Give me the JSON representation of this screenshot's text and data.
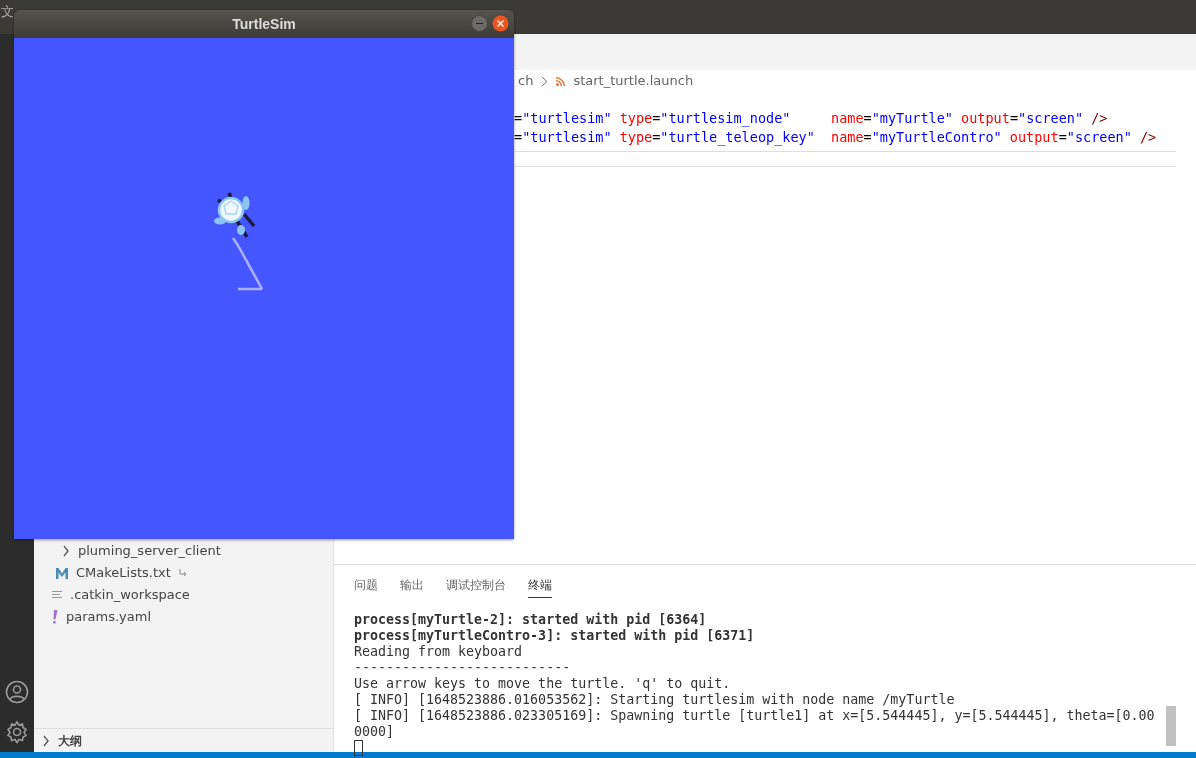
{
  "menu_bar": {
    "partial_label": "文"
  },
  "editor": {
    "breadcrumb": [
      {
        "label": "ch",
        "kind": "folder"
      },
      {
        "label": "start_turtle.launch",
        "kind": "file"
      }
    ],
    "code_lines": [
      [
        {
          "text": "=",
          "kind": "plain"
        },
        {
          "text": "\"turtlesim\" ",
          "kind": "string"
        },
        {
          "text": "type",
          "kind": "attr"
        },
        {
          "text": "=",
          "kind": "plain"
        },
        {
          "text": "\"turtlesim_node\"     ",
          "kind": "string"
        },
        {
          "text": "name",
          "kind": "attr"
        },
        {
          "text": "=",
          "kind": "plain"
        },
        {
          "text": "\"myTurtle\" ",
          "kind": "string"
        },
        {
          "text": "output",
          "kind": "attr"
        },
        {
          "text": "=",
          "kind": "plain"
        },
        {
          "text": "\"screen\" ",
          "kind": "string"
        },
        {
          "text": "/>",
          "kind": "tag"
        }
      ],
      [
        {
          "text": "=",
          "kind": "plain"
        },
        {
          "text": "\"turtlesim\" ",
          "kind": "string"
        },
        {
          "text": "type",
          "kind": "attr"
        },
        {
          "text": "=",
          "kind": "plain"
        },
        {
          "text": "\"turtle_teleop_key\"  ",
          "kind": "string"
        },
        {
          "text": "name",
          "kind": "attr"
        },
        {
          "text": "=",
          "kind": "plain"
        },
        {
          "text": "\"myTurtleContro\" ",
          "kind": "string"
        },
        {
          "text": "output",
          "kind": "attr"
        },
        {
          "text": "=",
          "kind": "plain"
        },
        {
          "text": "\"screen\" ",
          "kind": "string"
        },
        {
          "text": "/>",
          "kind": "tag"
        }
      ]
    ]
  },
  "sidebar": {
    "items": [
      {
        "label": "pluming_server_client",
        "kind": "folder",
        "expanded": false
      },
      {
        "label": "CMakeLists.txt",
        "kind": "cmake"
      },
      {
        "label": ".catkin_workspace",
        "kind": "text"
      },
      {
        "label": "params.yaml",
        "kind": "yaml"
      }
    ],
    "outline": {
      "label": "大纲",
      "expanded": false
    }
  },
  "panel": {
    "tabs": [
      {
        "label": "问题",
        "selected": false
      },
      {
        "label": "输出",
        "selected": false
      },
      {
        "label": "调试控制台",
        "selected": false
      },
      {
        "label": "终端",
        "selected": true
      }
    ],
    "terminal_lines": [
      {
        "text": "process[myTurtle-2]: started with pid [6364]",
        "bold": true
      },
      {
        "text": "process[myTurtleContro-3]: started with pid [6371]",
        "bold": true
      },
      {
        "text": "Reading from keyboard",
        "bold": false
      },
      {
        "text": "---------------------------",
        "bold": false
      },
      {
        "text": "Use arrow keys to move the turtle. 'q' to quit.",
        "bold": false
      },
      {
        "text": "[ INFO] [1648523886.016053562]: Starting turtlesim with node name /myTurtle",
        "bold": false
      },
      {
        "text": "[ INFO] [1648523886.023305169]: Spawning turtle [turtle1] at x=[5.544445], y=[5.544445], theta=[0.00",
        "bold": false
      },
      {
        "text": "0000]",
        "bold": false
      }
    ]
  },
  "turtlesim_window": {
    "title": "TurtleSim"
  }
}
